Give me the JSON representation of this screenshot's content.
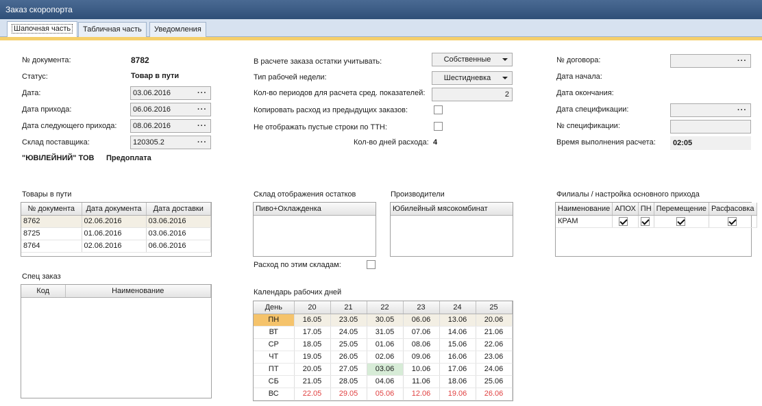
{
  "window": {
    "title": "Заказ скоропорта"
  },
  "tabs": [
    "Шапочная часть",
    "Табличная часть",
    "Уведомления"
  ],
  "left": {
    "doc_no_label": "№ документа:",
    "doc_no": "8782",
    "status_label": "Статус:",
    "status": "Товар в пути",
    "date_label": "Дата:",
    "date": "03.06.2016",
    "arrival_label": "Дата прихода:",
    "arrival": "06.06.2016",
    "next_arrival_label": "Дата следующего прихода:",
    "next_arrival": "08.06.2016",
    "warehouse_label": "Склад поставщика:",
    "warehouse": "120305.2",
    "supplier": "\"ЮВІЛЕЙНИЙ\" ТОВ",
    "payment": "Предоплата"
  },
  "middle": {
    "stock_label": "В расчете заказа остатки учитывать:",
    "stock_value": "Собственные",
    "week_label": "Тип рабочей недели:",
    "week_value": "Шестидневка",
    "periods_label": "Кол-во периодов для расчета сред. показателей:",
    "periods_value": "2",
    "copy_label": "Копировать расход из предыдущих заказов:",
    "hide_label": "Не отображать пустые строки по ТТН:",
    "days_label": "Кол-во дней расхода:",
    "days_value": "4"
  },
  "right": {
    "contract_label": "№ договора:",
    "start_label": "Дата начала:",
    "end_label": "Дата окончания:",
    "spec_date_label": "Дата спецификации:",
    "spec_no_label": "№ спецификации:",
    "calc_time_label": "Время выполнения расчета:",
    "calc_time": "02:05"
  },
  "in_transit": {
    "title": "Товары в пути",
    "columns": [
      "№ документа",
      "Дата документа",
      "Дата доставки"
    ],
    "rows": [
      [
        "8762",
        "02.06.2016",
        "03.06.2016"
      ],
      [
        "8725",
        "01.06.2016",
        "03.06.2016"
      ],
      [
        "8764",
        "02.06.2016",
        "06.06.2016"
      ]
    ]
  },
  "stock_warehouse": {
    "title": "Склад отображения остатков",
    "header": "Пиво+Охлажденка",
    "consumption_label": "Расход по этим складам:"
  },
  "producers": {
    "title": "Производители",
    "header": "Юбилейный мясокомбинат"
  },
  "branches": {
    "title": "Филиалы / настройка основного прихода",
    "columns": [
      "Наименование",
      "АПОХ",
      "ПН",
      "Перемещение",
      "Расфасовка"
    ],
    "row": "КРАМ"
  },
  "special": {
    "title": "Спец заказ",
    "columns": [
      "Код",
      "Наименование"
    ]
  },
  "calendar": {
    "title": "Календарь рабочих дней",
    "day_header": "День",
    "weeks": [
      "20",
      "21",
      "22",
      "23",
      "24",
      "25"
    ],
    "rows": [
      {
        "day": "ПН",
        "dates": [
          "16.05",
          "23.05",
          "30.05",
          "06.06",
          "13.06",
          "20.06"
        ]
      },
      {
        "day": "ВТ",
        "dates": [
          "17.05",
          "24.05",
          "31.05",
          "07.06",
          "14.06",
          "21.06"
        ]
      },
      {
        "day": "СР",
        "dates": [
          "18.05",
          "25.05",
          "01.06",
          "08.06",
          "15.06",
          "22.06"
        ]
      },
      {
        "day": "ЧТ",
        "dates": [
          "19.05",
          "26.05",
          "02.06",
          "09.06",
          "16.06",
          "23.06"
        ]
      },
      {
        "day": "ПТ",
        "dates": [
          "20.05",
          "27.05",
          "03.06",
          "10.06",
          "17.06",
          "24.06"
        ]
      },
      {
        "day": "СБ",
        "dates": [
          "21.05",
          "28.05",
          "04.06",
          "11.06",
          "18.06",
          "25.06"
        ]
      },
      {
        "day": "ВС",
        "dates": [
          "22.05",
          "29.05",
          "05.06",
          "12.06",
          "19.06",
          "26.06"
        ]
      }
    ]
  },
  "colors": {
    "accent": "#f5cf6b",
    "title_bar": "#3b5b85",
    "weekend": "#e04040",
    "today": "#d7ecd7",
    "day_highlight": "#f5c36b"
  }
}
